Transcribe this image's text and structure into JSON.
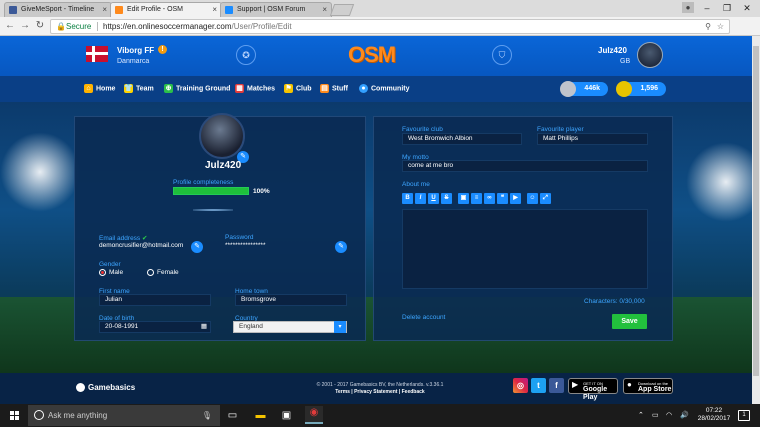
{
  "browser": {
    "tabs": [
      {
        "title": "GiveMeSport - Timeline",
        "favicon_color": "#3b5998",
        "active": false
      },
      {
        "title": "Edit Profile - OSM",
        "favicon_color": "#ff8a1c",
        "active": true
      },
      {
        "title": "Support | OSM Forum",
        "favicon_color": "#1a8cff",
        "active": false
      }
    ],
    "close_glyph": "×",
    "address": {
      "secure_label": "Secure",
      "url_host": "https://en.onlinesoccermanager.com",
      "url_path": "/User/Profile/Edit"
    }
  },
  "header": {
    "club_name": "Viborg FF",
    "country": "Danmarca",
    "logo_text": "OSM",
    "username": "Julz420",
    "user_code": "GB",
    "warning_glyph": "!"
  },
  "nav": {
    "items": [
      {
        "label": "Home",
        "icon": "home-icon",
        "color": "#ffb300"
      },
      {
        "label": "Team",
        "icon": "team-icon",
        "color": "#ffd400"
      },
      {
        "label": "Training Ground",
        "icon": "training-icon",
        "color": "#2bbf4a"
      },
      {
        "label": "Matches",
        "icon": "matches-icon",
        "color": "#e23b3b"
      },
      {
        "label": "Club",
        "icon": "club-icon",
        "color": "#f5c400"
      },
      {
        "label": "Stuff",
        "icon": "stuff-icon",
        "color": "#ff8a1c"
      },
      {
        "label": "Community",
        "icon": "community-icon",
        "color": "#33a0ff"
      }
    ],
    "savings": "446k",
    "bosscoins": "1,596"
  },
  "profile": {
    "player_name": "Julz420",
    "completeness_label": "Profile completeness",
    "completeness_pct": 100,
    "completeness_text": "100%",
    "email_label": "Email address",
    "email_value": "demoncrusifier@hotmail.com",
    "password_label": "Password",
    "password_value": "****************",
    "gender_label": "Gender",
    "gender_options": [
      "Male",
      "Female"
    ],
    "gender_selected": "Male",
    "first_name_label": "First name",
    "first_name_value": "Julian",
    "home_town_label": "Home town",
    "home_town_value": "Bromsgrove",
    "dob_label": "Date of birth",
    "dob_value": "20-08-1991",
    "country_label": "Country",
    "country_value": "England"
  },
  "preferences": {
    "favourite_club_label": "Favourite club",
    "favourite_club_value": "West Bromwich Albion",
    "favourite_player_label": "Favourite player",
    "favourite_player_value": "Matt Phillips",
    "motto_label": "My motto",
    "motto_value": "come at me bro",
    "about_label": "About me",
    "toolbar": [
      "B",
      "I",
      "U",
      "S"
    ],
    "characters_text": "Characters: 0/30,000",
    "delete_label": "Delete account",
    "save_label": "Save"
  },
  "footer": {
    "brand": "Gamebasics",
    "copyright": "© 2001 - 2017 Gamebasics BV, the Netherlands. v.3.36.1",
    "links": "Terms | Privacy Statement | Feedback",
    "google_play_small": "GET IT ON",
    "google_play_big": "Google Play",
    "app_store_small": "Download on the",
    "app_store_big": "App Store"
  },
  "taskbar": {
    "search_placeholder": "Ask me anything",
    "time": "07:22",
    "date": "28/02/2017",
    "notifications": "1"
  }
}
